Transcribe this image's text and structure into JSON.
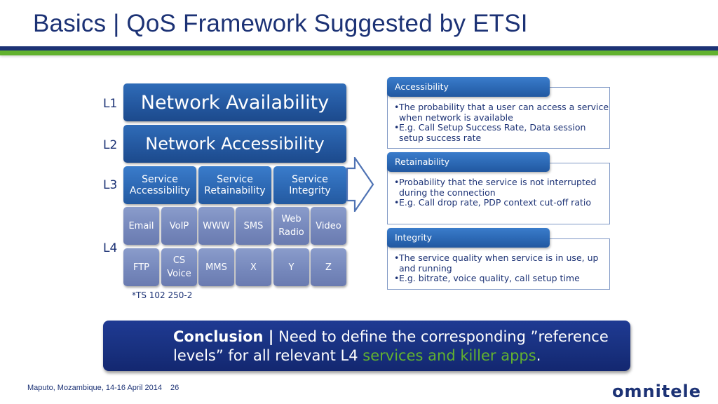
{
  "slide": {
    "title": "Basics | QoS Framework Suggested by ETSI",
    "colors": {
      "navy": "#1c3275",
      "green": "#62b22f",
      "blue": "#2c67b2"
    }
  },
  "pyramid": {
    "level_labels": [
      "L1",
      "L2",
      "L3",
      "L4"
    ],
    "l1": "Network Availability",
    "l2": "Network Accessibility",
    "l3": [
      {
        "line1": "Service",
        "line2": "Accessibility"
      },
      {
        "line1": "Service",
        "line2": "Retainability"
      },
      {
        "line1": "Service",
        "line2": "Integrity"
      }
    ],
    "l4_row1": [
      {
        "line1": "Email",
        "line2": ""
      },
      {
        "line1": "VoIP",
        "line2": ""
      },
      {
        "line1": "WWW",
        "line2": ""
      },
      {
        "line1": "SMS",
        "line2": ""
      },
      {
        "line1": "Web",
        "line2": "Radio"
      },
      {
        "line1": "Video",
        "line2": ""
      }
    ],
    "l4_row2": [
      {
        "line1": "FTP",
        "line2": ""
      },
      {
        "line1": "CS",
        "line2": "Voice"
      },
      {
        "line1": "MMS",
        "line2": ""
      },
      {
        "line1": "X",
        "line2": ""
      },
      {
        "line1": "Y",
        "line2": ""
      },
      {
        "line1": "Z",
        "line2": ""
      }
    ],
    "footnote": "*TS 102 250-2",
    "arrow_icon": "right-arrow"
  },
  "panels": [
    {
      "title": "Accessibility",
      "bullets": [
        "The probability that a user can access a service when network is available",
        "E.g. Call Setup Success Rate, Data session setup success rate"
      ]
    },
    {
      "title": "Retainability",
      "bullets": [
        "Probability that the service is not interrupted during the connection",
        "E.g. Call drop rate, PDP context cut-off ratio"
      ]
    },
    {
      "title": "Integrity",
      "bullets": [
        "The service quality when service is in use, up and running",
        "E.g. bitrate, voice quality, call setup time"
      ]
    }
  ],
  "conclusion": {
    "label": "Conclusion |",
    "text1": " Need to define the corresponding ”reference levels” for all relevant L4 ",
    "highlight": "services and killer apps",
    "text2": "."
  },
  "footer": {
    "location": "Maputo, Mozambique, 14-16 April 2014",
    "page": "26",
    "logo": "omnitele"
  }
}
